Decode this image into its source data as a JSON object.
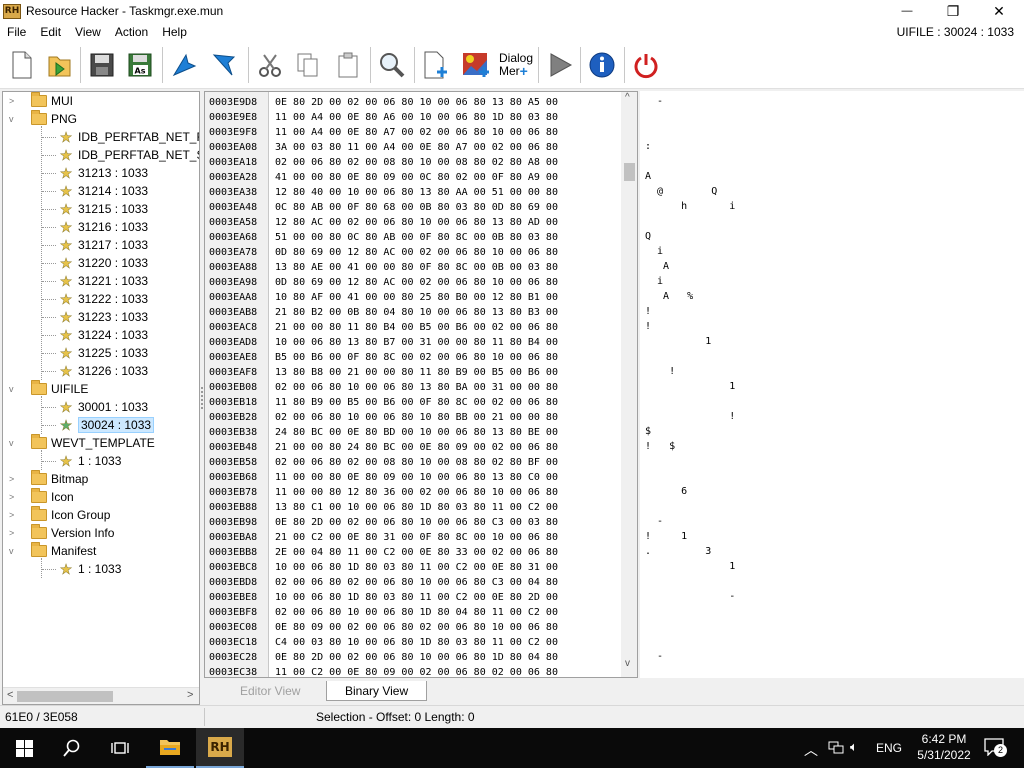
{
  "window": {
    "title": "Resource Hacker - Taskmgr.exe.mun",
    "logo_text": "RH",
    "restore_glyph": "❐",
    "close_glyph": "✕",
    "minimize_glyph": "—"
  },
  "menu": {
    "items": [
      "File",
      "Edit",
      "View",
      "Action",
      "Help"
    ],
    "right_label": "UIFILE : 30024 : 1033"
  },
  "toolbar": {
    "dialog_merge_label_1": "Dialog",
    "dialog_merge_label_2": "Mer"
  },
  "tree": {
    "items": [
      {
        "label": "MUI",
        "type": "folder",
        "level": 0,
        "expand": ">"
      },
      {
        "label": "PNG",
        "type": "folder",
        "level": 0,
        "expand": "v"
      },
      {
        "label": "IDB_PERFTAB_NET_R",
        "type": "star",
        "level": 1
      },
      {
        "label": "IDB_PERFTAB_NET_S",
        "type": "star",
        "level": 1
      },
      {
        "label": "31213 : 1033",
        "type": "star",
        "level": 1
      },
      {
        "label": "31214 : 1033",
        "type": "star",
        "level": 1
      },
      {
        "label": "31215 : 1033",
        "type": "star",
        "level": 1
      },
      {
        "label": "31216 : 1033",
        "type": "star",
        "level": 1
      },
      {
        "label": "31217 : 1033",
        "type": "star",
        "level": 1
      },
      {
        "label": "31220 : 1033",
        "type": "star",
        "level": 1
      },
      {
        "label": "31221 : 1033",
        "type": "star",
        "level": 1
      },
      {
        "label": "31222 : 1033",
        "type": "star",
        "level": 1
      },
      {
        "label": "31223 : 1033",
        "type": "star",
        "level": 1
      },
      {
        "label": "31224 : 1033",
        "type": "star",
        "level": 1
      },
      {
        "label": "31225 : 1033",
        "type": "star",
        "level": 1
      },
      {
        "label": "31226 : 1033",
        "type": "star",
        "level": 1
      },
      {
        "label": "UIFILE",
        "type": "folder",
        "level": 0,
        "expand": "v"
      },
      {
        "label": "30001 : 1033",
        "type": "star",
        "level": 1
      },
      {
        "label": "30024 : 1033",
        "type": "star",
        "level": 1,
        "selected": true
      },
      {
        "label": "WEVT_TEMPLATE",
        "type": "folder",
        "level": 0,
        "expand": "v"
      },
      {
        "label": "1 : 1033",
        "type": "star",
        "level": 1
      },
      {
        "label": "Bitmap",
        "type": "folder",
        "level": 0,
        "expand": ">"
      },
      {
        "label": "Icon",
        "type": "folder",
        "level": 0,
        "expand": ">"
      },
      {
        "label": "Icon Group",
        "type": "folder",
        "level": 0,
        "expand": ">"
      },
      {
        "label": "Version Info",
        "type": "folder",
        "level": 0,
        "expand": ">"
      },
      {
        "label": "Manifest",
        "type": "folder",
        "level": 0,
        "expand": "v"
      },
      {
        "label": "1 : 1033",
        "type": "star",
        "level": 1
      }
    ],
    "scroll_left": "<",
    "scroll_right": ">"
  },
  "hex": {
    "rows": [
      {
        "addr": "0003E9D8",
        "bytes": "0E 80 2D 00 02 00 06 80 10 00 06 80 13 80 A5 00",
        "ascii": "  -"
      },
      {
        "addr": "0003E9E8",
        "bytes": "11 00 A4 00 0E 80 A6 00 10 00 06 80 1D 80 03 80",
        "ascii": ""
      },
      {
        "addr": "0003E9F8",
        "bytes": "11 00 A4 00 0E 80 A7 00 02 00 06 80 10 00 06 80",
        "ascii": ""
      },
      {
        "addr": "0003EA08",
        "bytes": "3A 00 03 80 11 00 A4 00 0E 80 A7 00 02 00 06 80",
        "ascii": ":"
      },
      {
        "addr": "0003EA18",
        "bytes": "02 00 06 80 02 00 08 80 10 00 08 80 02 80 A8 00",
        "ascii": ""
      },
      {
        "addr": "0003EA28",
        "bytes": "41 00 00 80 0E 80 09 00 0C 80 02 00 0F 80 A9 00",
        "ascii": "A"
      },
      {
        "addr": "0003EA38",
        "bytes": "12 80 40 00 10 00 06 80 13 80 AA 00 51 00 00 80",
        "ascii": "  @        Q"
      },
      {
        "addr": "0003EA48",
        "bytes": "0C 80 AB 00 0F 80 68 00 0B 80 03 80 0D 80 69 00",
        "ascii": "      h       i"
      },
      {
        "addr": "0003EA58",
        "bytes": "12 80 AC 00 02 00 06 80 10 00 06 80 13 80 AD 00",
        "ascii": ""
      },
      {
        "addr": "0003EA68",
        "bytes": "51 00 00 80 0C 80 AB 00 0F 80 8C 00 0B 80 03 80",
        "ascii": "Q"
      },
      {
        "addr": "0003EA78",
        "bytes": "0D 80 69 00 12 80 AC 00 02 00 06 80 10 00 06 80",
        "ascii": "  i"
      },
      {
        "addr": "0003EA88",
        "bytes": "13 80 AE 00 41 00 00 80 0F 80 8C 00 0B 00 03 80",
        "ascii": "   A"
      },
      {
        "addr": "0003EA98",
        "bytes": "0D 80 69 00 12 80 AC 00 02 00 06 80 10 00 06 80",
        "ascii": "  i"
      },
      {
        "addr": "0003EAA8",
        "bytes": "10 80 AF 00 41 00 00 80 25 80 B0 00 12 80 B1 00",
        "ascii": "   A   %"
      },
      {
        "addr": "0003EAB8",
        "bytes": "21 80 B2 00 0B 80 04 80 10 00 06 80 13 80 B3 00",
        "ascii": "!"
      },
      {
        "addr": "0003EAC8",
        "bytes": "21 00 00 80 11 80 B4 00 B5 00 B6 00 02 00 06 80",
        "ascii": "!"
      },
      {
        "addr": "0003EAD8",
        "bytes": "10 00 06 80 13 80 B7 00 31 00 00 80 11 80 B4 00",
        "ascii": "          1"
      },
      {
        "addr": "0003EAE8",
        "bytes": "B5 00 B6 00 0F 80 8C 00 02 00 06 80 10 00 06 80",
        "ascii": ""
      },
      {
        "addr": "0003EAF8",
        "bytes": "13 80 B8 00 21 00 00 80 11 80 B9 00 B5 00 B6 00",
        "ascii": "    !"
      },
      {
        "addr": "0003EB08",
        "bytes": "02 00 06 80 10 00 06 80 13 80 BA 00 31 00 00 80",
        "ascii": "              1"
      },
      {
        "addr": "0003EB18",
        "bytes": "11 80 B9 00 B5 00 B6 00 0F 80 8C 00 02 00 06 80",
        "ascii": ""
      },
      {
        "addr": "0003EB28",
        "bytes": "02 00 06 80 10 00 06 80 10 80 BB 00 21 00 00 80",
        "ascii": "              !"
      },
      {
        "addr": "0003EB38",
        "bytes": "24 80 BC 00 0E 80 BD 00 10 00 06 80 13 80 BE 00",
        "ascii": "$"
      },
      {
        "addr": "0003EB48",
        "bytes": "21 00 00 80 24 80 BC 00 0E 80 09 00 02 00 06 80",
        "ascii": "!   $"
      },
      {
        "addr": "0003EB58",
        "bytes": "02 00 06 80 02 00 08 80 10 00 08 80 02 80 BF 00",
        "ascii": ""
      },
      {
        "addr": "0003EB68",
        "bytes": "11 00 00 80 0E 80 09 00 10 00 06 80 13 80 C0 00",
        "ascii": ""
      },
      {
        "addr": "0003EB78",
        "bytes": "11 00 00 80 12 80 36 00 02 00 06 80 10 00 06 80",
        "ascii": "      6"
      },
      {
        "addr": "0003EB88",
        "bytes": "13 80 C1 00 10 00 06 80 1D 80 03 80 11 00 C2 00",
        "ascii": ""
      },
      {
        "addr": "0003EB98",
        "bytes": "0E 80 2D 00 02 00 06 80 10 00 06 80 C3 00 03 80",
        "ascii": "  -"
      },
      {
        "addr": "0003EBA8",
        "bytes": "21 00 C2 00 0E 80 31 00 0F 80 8C 00 10 00 06 80",
        "ascii": "!     1"
      },
      {
        "addr": "0003EBB8",
        "bytes": "2E 00 04 80 11 00 C2 00 0E 80 33 00 02 00 06 80",
        "ascii": ".         3"
      },
      {
        "addr": "0003EBC8",
        "bytes": "10 00 06 80 1D 80 03 80 11 00 C2 00 0E 80 31 00",
        "ascii": "              1"
      },
      {
        "addr": "0003EBD8",
        "bytes": "02 00 06 80 02 00 06 80 10 00 06 80 C3 00 04 80",
        "ascii": ""
      },
      {
        "addr": "0003EBE8",
        "bytes": "10 00 06 80 1D 80 03 80 11 00 C2 00 0E 80 2D 00",
        "ascii": "              -"
      },
      {
        "addr": "0003EBF8",
        "bytes": "02 00 06 80 10 00 06 80 1D 80 04 80 11 00 C2 00",
        "ascii": ""
      },
      {
        "addr": "0003EC08",
        "bytes": "0E 80 09 00 02 00 06 80 02 00 06 80 10 00 06 80",
        "ascii": ""
      },
      {
        "addr": "0003EC18",
        "bytes": "C4 00 03 80 10 00 06 80 1D 80 03 80 11 00 C2 00",
        "ascii": ""
      },
      {
        "addr": "0003EC28",
        "bytes": "0E 80 2D 00 02 00 06 80 10 00 06 80 1D 80 04 80",
        "ascii": "  -"
      },
      {
        "addr": "0003EC38",
        "bytes": "11 00 C2 00 0E 80 09 00 02 00 06 80 02 00 06 80",
        "ascii": ""
      }
    ],
    "scroll_up": "^",
    "scroll_down": "v"
  },
  "tabs": {
    "editor_view": "Editor View",
    "binary_view": "Binary View"
  },
  "status": {
    "left": "61E0 / 3E058",
    "selection": "Selection - Offset: 0 Length: 0"
  },
  "taskbar": {
    "lang": "ENG",
    "time": "6:42 PM",
    "date": "5/31/2022",
    "notif_count": "2",
    "rh_label": "RH"
  }
}
